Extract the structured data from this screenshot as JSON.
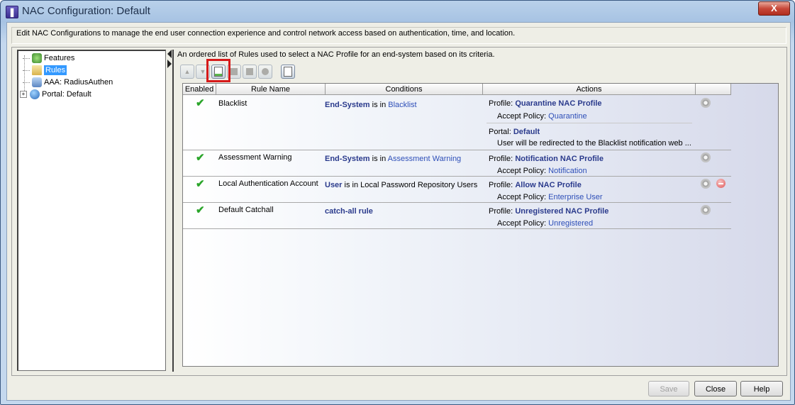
{
  "window": {
    "title": "NAC Configuration: Default",
    "close_label": "X"
  },
  "description": "Edit NAC Configurations to manage the end user connection experience and control network access based on authentication, time, and location.",
  "tree": {
    "items": [
      {
        "label": "Features"
      },
      {
        "label": "Rules",
        "selected": true
      },
      {
        "label": "AAA: RadiusAuthen"
      },
      {
        "label": "Portal: Default",
        "expandable": true
      }
    ]
  },
  "rules_panel": {
    "description": "An ordered list of Rules used to select a NAC Profile for an end-system based on its criteria.",
    "toolbar": [
      "move-up",
      "move-down",
      "add-rule",
      "edit-rule",
      "copy-rule",
      "delete-rule",
      "rule-settings"
    ],
    "columns": [
      "Enabled",
      "Rule Name",
      "Conditions",
      "Actions"
    ],
    "rules": [
      {
        "enabled": true,
        "name": "Blacklist",
        "cond_subject": "End-System",
        "cond_op": "is in",
        "cond_value": "Blacklist",
        "profile_label": "Profile:",
        "profile": "Quarantine NAC Profile",
        "policy_label": "Accept Policy:",
        "policy": "Quarantine",
        "portal_label": "Portal:",
        "portal": "Default",
        "portal_note": "User will be redirected to the Blacklist notification web ..."
      },
      {
        "enabled": true,
        "name": "Assessment Warning",
        "cond_subject": "End-System",
        "cond_op": "is in",
        "cond_value": "Assessment Warning",
        "profile_label": "Profile:",
        "profile": "Notification NAC Profile",
        "policy_label": "Accept Policy:",
        "policy": "Notification"
      },
      {
        "enabled": true,
        "name": "Local Authentication Account",
        "cond_subject": "User",
        "cond_op": "is in Local Password Repository Users",
        "cond_value": "",
        "profile_label": "Profile:",
        "profile": "Allow NAC Profile",
        "policy_label": "Accept Policy:",
        "policy": "Enterprise User"
      },
      {
        "enabled": true,
        "name": "Default Catchall",
        "cond_subject": "catch-all rule",
        "cond_op": "",
        "cond_value": "",
        "profile_label": "Profile:",
        "profile": "Unregistered NAC Profile",
        "policy_label": "Accept Policy:",
        "policy": "Unregistered"
      }
    ]
  },
  "buttons": {
    "save": "Save",
    "close": "Close",
    "help": "Help"
  },
  "colors": {
    "highlight_box": "#d61a1a",
    "selected_tree": "#3399ff",
    "link_text": "#2e4fb8",
    "check": "#2aa52a"
  }
}
